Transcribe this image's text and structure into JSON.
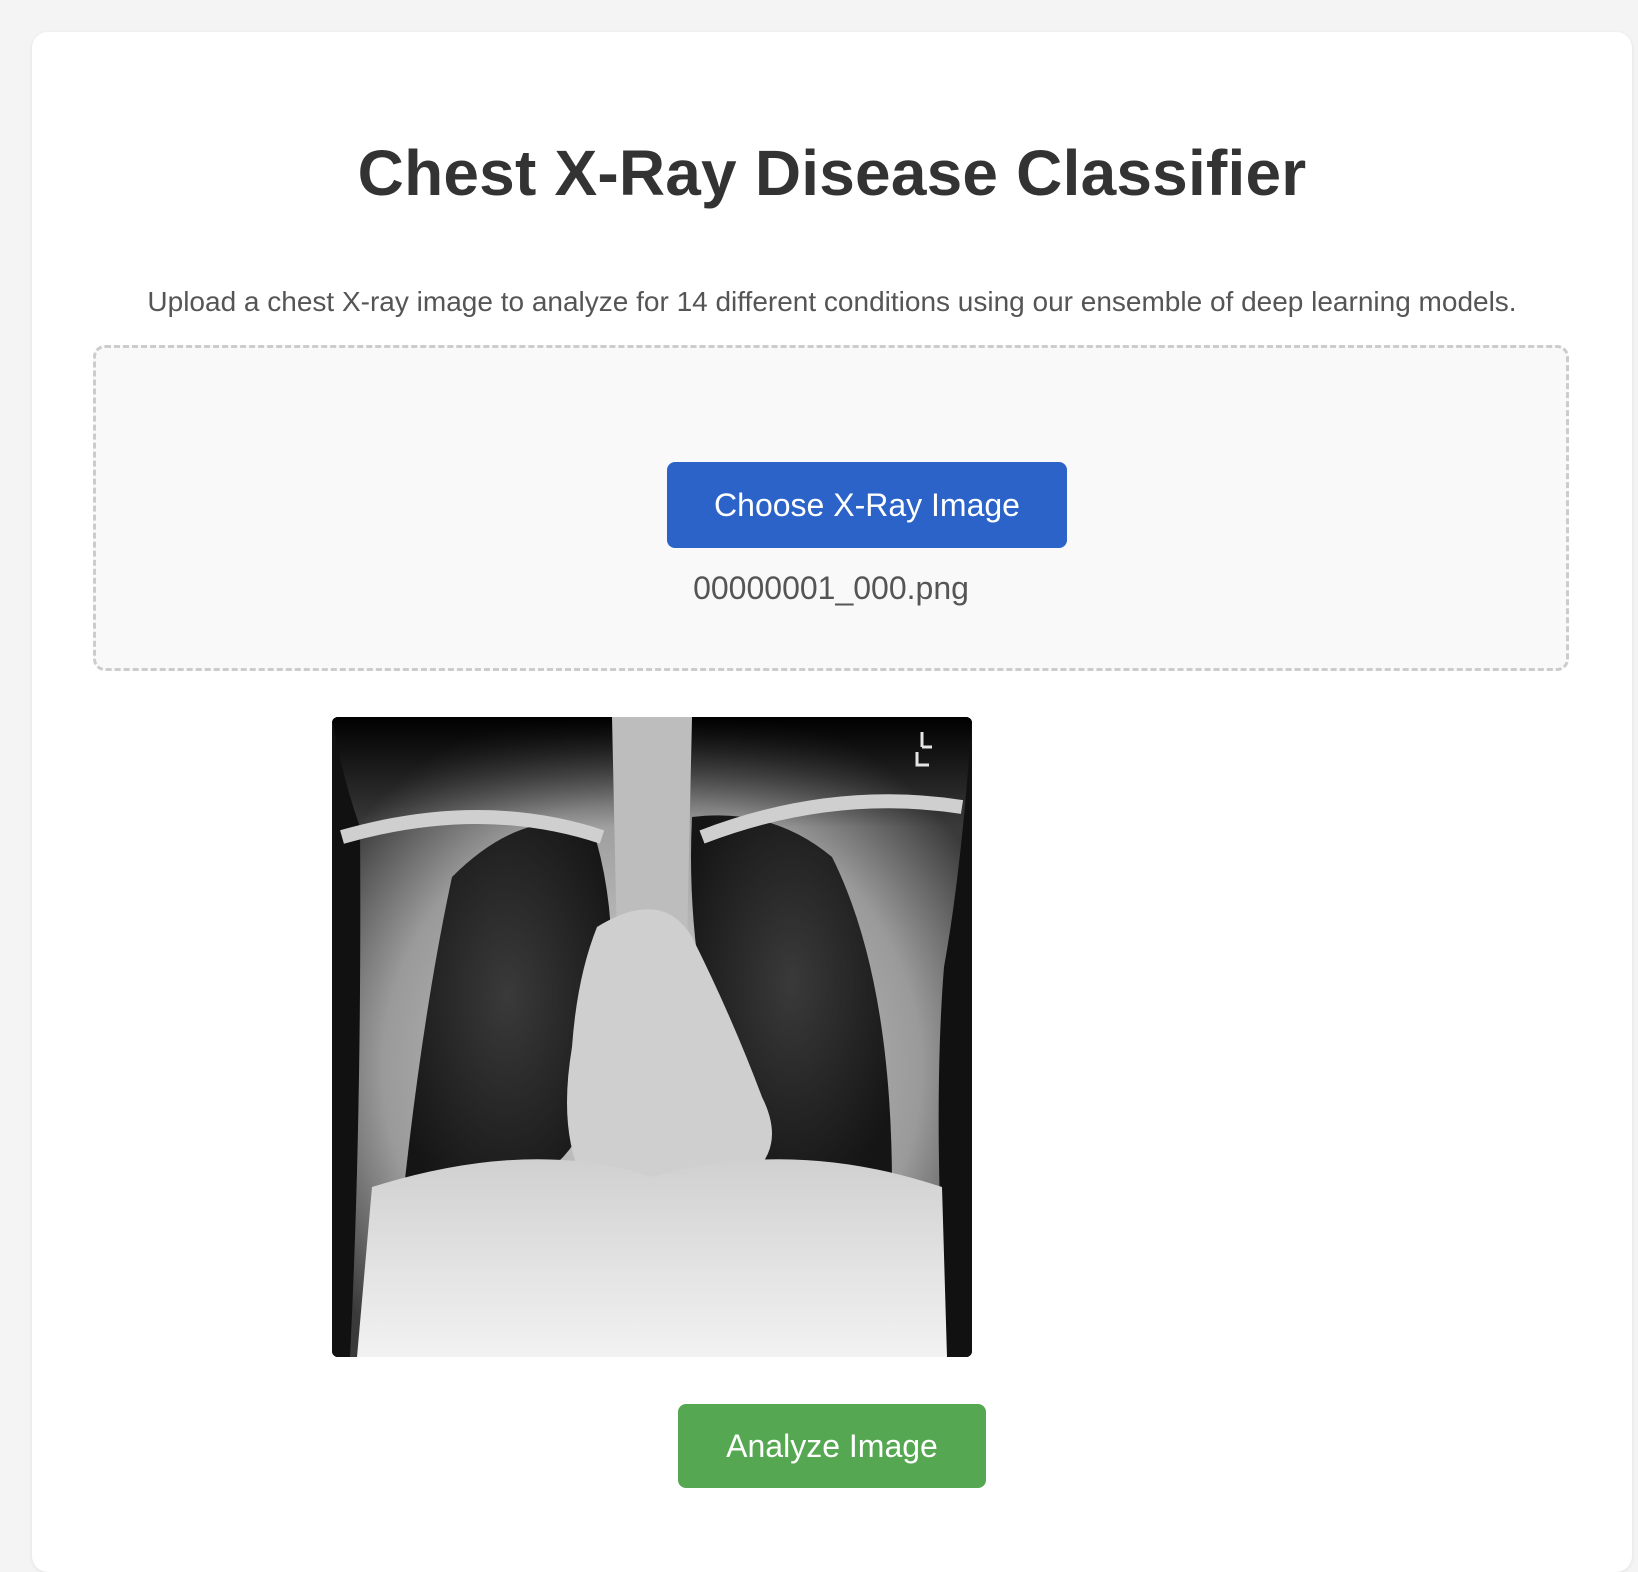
{
  "header": {
    "title": "Chest X-Ray Disease Classifier",
    "subtitle": "Upload a chest X-ray image to analyze for 14 different conditions using our ensemble of deep learning models."
  },
  "upload": {
    "choose_label": "Choose X-Ray Image",
    "file_name": "00000001_000.png"
  },
  "preview": {
    "image_icon": "chest-xray-image"
  },
  "actions": {
    "analyze_label": "Analyze Image",
    "analyze_color": "#55a851",
    "choose_color": "#2b63c9"
  }
}
